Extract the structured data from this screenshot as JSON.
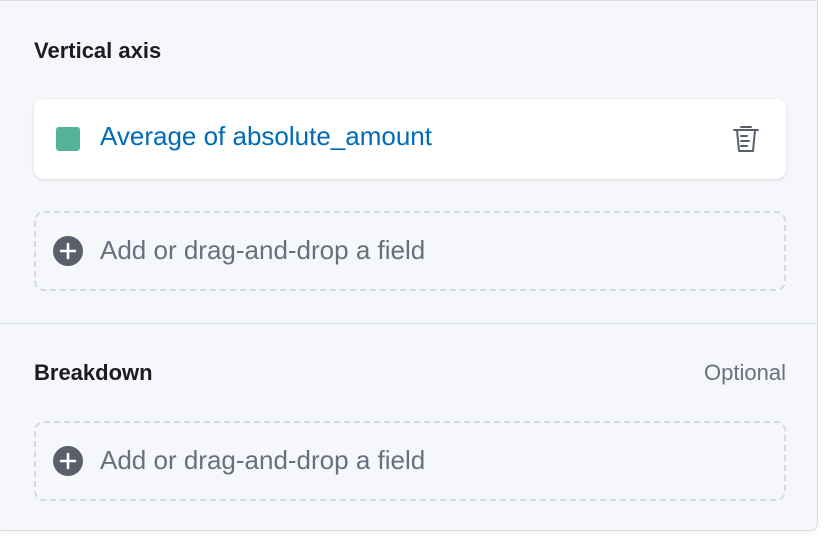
{
  "vertical_axis": {
    "title": "Vertical axis",
    "field": {
      "label": "Average of absolute_amount",
      "color": "#54b399",
      "remove_icon": "trash-icon"
    },
    "add_field_label": "Add or drag-and-drop a field",
    "add_icon": "plus-circle-icon"
  },
  "breakdown": {
    "title": "Breakdown",
    "optional_label": "Optional",
    "add_field_label": "Add or drag-and-drop a field",
    "add_icon": "plus-circle-icon"
  }
}
